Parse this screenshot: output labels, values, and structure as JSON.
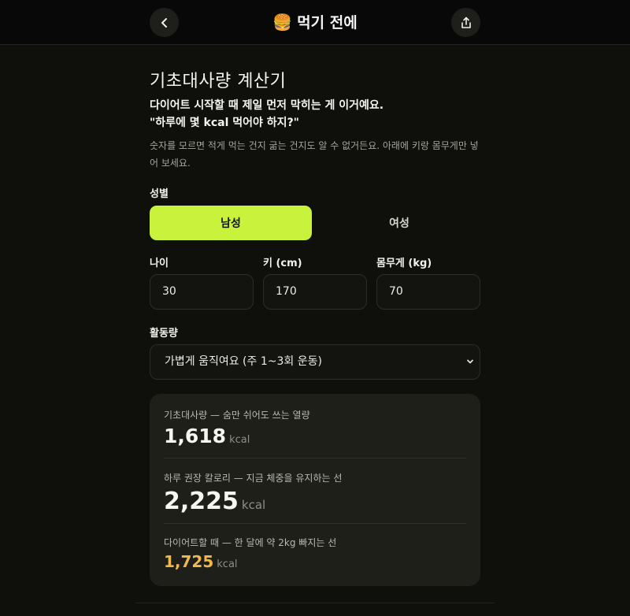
{
  "header": {
    "title": "먹기 전에",
    "emoji": "🍔",
    "back_icon": "chevron-left-icon",
    "share_icon": "share-icon"
  },
  "calculator": {
    "title": "기초대사량 계산기",
    "intro_line1": "다이어트 시작할 때 제일 먼저 막히는 게 이거예요.",
    "intro_line2": "\"하루에 몇 kcal 먹어야 하지?\"",
    "description": "숫자를 모르면 적게 먹는 건지 굶는 건지도 알 수 없거든요. 아래에 키랑 몸무게만 넣어 보세요.",
    "gender": {
      "label": "성별",
      "options": [
        "남성",
        "여성"
      ],
      "selected": "남성"
    },
    "age": {
      "label": "나이",
      "value": "30"
    },
    "height": {
      "label": "키 (cm)",
      "value": "170"
    },
    "weight": {
      "label": "몸무게 (kg)",
      "value": "70"
    },
    "activity": {
      "label": "활동량",
      "selected": "가볍게 움직여요 (주 1~3회 운동)"
    }
  },
  "results": {
    "bmr": {
      "label": "기초대사량 — 숨만 쉬어도 쓰는 열량",
      "value": "1,618",
      "unit": "kcal"
    },
    "tdee": {
      "label": "하루 권장 칼로리 — 지금 체중을 유지하는 선",
      "value": "2,225",
      "unit": "kcal"
    },
    "diet": {
      "label": "다이어트할 때 — 한 달에 약 2kg 빠지는 선",
      "value": "1,725",
      "unit": "kcal"
    }
  },
  "colors": {
    "accent": "#c8f23c",
    "diet_value": "#f0b94e",
    "background": "#0f0f0b"
  }
}
